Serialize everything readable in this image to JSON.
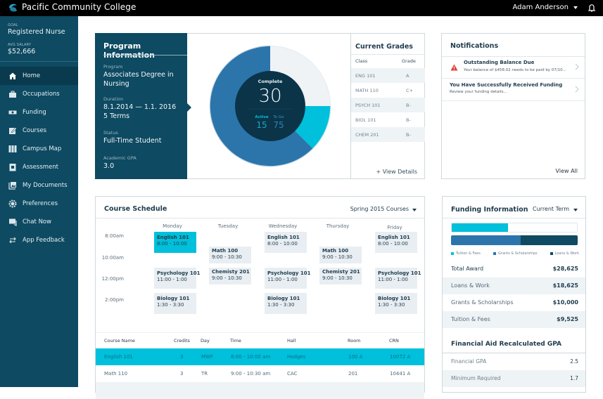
{
  "header": {
    "app_title": "Pacific Community College",
    "user_name": "Adam Anderson",
    "logo_icon": "wave-logo-icon",
    "bell_icon": "bell-icon"
  },
  "sidebar": {
    "goal_label": "GOAL",
    "goal_value": "Registered Nurse",
    "salary_label": "AVG SALARY",
    "salary_value": "$52,666",
    "items": [
      {
        "label": "Home",
        "icon": "home-icon",
        "active": true
      },
      {
        "label": "Occupations",
        "icon": "briefcase-icon"
      },
      {
        "label": "Funding",
        "icon": "money-icon"
      },
      {
        "label": "Courses",
        "icon": "edit-icon"
      },
      {
        "label": "Campus Map",
        "icon": "map-icon"
      },
      {
        "label": "Assessment",
        "icon": "clipboard-icon"
      },
      {
        "label": "My Documents",
        "icon": "documents-icon"
      },
      {
        "label": "Preferences",
        "icon": "gear-icon"
      },
      {
        "label": "Chat Now",
        "icon": "chat-icon"
      },
      {
        "label": "App Feedback",
        "icon": "arrows-icon"
      }
    ]
  },
  "program": {
    "title": "Program Information",
    "program_label": "Program",
    "program_value": "Associates Degree in Nursing",
    "duration_label": "Duration",
    "duration_value": "8.1.2014 — 1.1. 2016",
    "terms_value": "5 Terms",
    "status_label": "Status",
    "status_value": "Full-Time Student",
    "gpa_label": "Academic GPA",
    "gpa_value": "3.0"
  },
  "credits": {
    "complete_label": "Complete",
    "complete_value": "30",
    "active_label": "Active",
    "active_value": "15",
    "togo_label": "To Go",
    "togo_value": "75",
    "colors": {
      "complete": "#eff3f6",
      "active": "#00c0db",
      "togo": "#2b75ab",
      "center": "#0b3448"
    }
  },
  "grades": {
    "title": "Current Grades",
    "col_class": "Class",
    "col_grade": "Grade",
    "rows": [
      {
        "class": "ENG 101",
        "grade": "A"
      },
      {
        "class": "MATH 110",
        "grade": "C+"
      },
      {
        "class": "PSYCH 101",
        "grade": "B-"
      },
      {
        "class": "BIOL 101",
        "grade": "B-"
      },
      {
        "class": "CHEM 201",
        "grade": "B-"
      }
    ],
    "view_details": "+ View Details"
  },
  "notifications": {
    "title": "Notifications",
    "items": [
      {
        "title": "Outstanding Balance Due",
        "subtitle": "Your balance of $458.02 needs to be paid by 07/10...",
        "icon": "warning-icon"
      },
      {
        "title": "You Have Successfully Received Funding",
        "subtitle": "Review your funding details..."
      }
    ],
    "view_all": "View All"
  },
  "schedule": {
    "title": "Course Schedule",
    "term_select": "Spring 2015 Courses",
    "days": [
      "Monday",
      "Tuesday",
      "Wednesday",
      "Thursday",
      "Friday"
    ],
    "times": [
      "8:00am",
      "10:00am",
      "12:00pm",
      "2:00pm"
    ],
    "blocks": {
      "mon_eng": {
        "name": "English 101",
        "hours": "8:00 - 10:00"
      },
      "mon_psy": {
        "name": "Psychology 101",
        "hours": "11:00 - 1:00"
      },
      "mon_bio": {
        "name": "Biology 101",
        "hours": "1:30 - 3:30"
      },
      "tue_math": {
        "name": "Math 100",
        "hours": "9:00 - 10:30"
      },
      "tue_chem": {
        "name": "Chemisty 201",
        "hours": "9:00 - 10:30"
      },
      "wed_eng": {
        "name": "English 101",
        "hours": "8:00 - 10:00"
      },
      "wed_psy": {
        "name": "Psychology 101",
        "hours": "11:00 - 1:00"
      },
      "wed_bio": {
        "name": "Biology 101",
        "hours": "1:30 - 3:30"
      },
      "thu_math": {
        "name": "Math 100",
        "hours": "9:00 - 10:30"
      },
      "thu_chem": {
        "name": "Chemisty 201",
        "hours": "9:00 - 10:30"
      },
      "fri_eng": {
        "name": "English 101",
        "hours": "8:00 - 10:00"
      },
      "fri_psy": {
        "name": "Psychology 101",
        "hours": "11:00 - 1:00"
      },
      "fri_bio": {
        "name": "Biology 101",
        "hours": "1:30 - 3:30"
      }
    },
    "table": {
      "columns": [
        "Course Name",
        "Credits",
        "Day",
        "Time",
        "Hall",
        "Room",
        "CRN"
      ],
      "rows": [
        [
          "English 101",
          "3",
          "MWF",
          "8:00 - 10:00 am",
          "Hodges",
          "100 A",
          "10072 A"
        ],
        [
          "Math 110",
          "3",
          "TR",
          "9:00 - 10:30 am",
          "CAC",
          "201",
          "10441 A"
        ]
      ]
    },
    "highlight_color": "#00c0db"
  },
  "funding": {
    "title": "Funding Information",
    "term_select": "Current Term",
    "bars": {
      "tuition_fraction": 0.45,
      "grants_fraction": 0.55,
      "loans_fraction": 0.45
    },
    "legend": [
      {
        "label": "Tuition & Fees",
        "color": "#00c0db"
      },
      {
        "label": "Grants & Scholarships",
        "color": "#2b75ab"
      },
      {
        "label": "Loans & Work",
        "color": "#0e4a62"
      }
    ],
    "rows": [
      {
        "label": "Total Award",
        "value": "$28,625"
      },
      {
        "label": "Loans & Work",
        "value": "$18,625"
      },
      {
        "label": "Grants & Scholarships",
        "value": "$10,000"
      },
      {
        "label": "Tuition & Fees",
        "value": "$9,525"
      }
    ],
    "gpa_title": "Financial Aid Recalculated GPA",
    "gpa_rows": [
      {
        "label": "Financial GPA",
        "value": "2.5"
      },
      {
        "label": "Minimum Required",
        "value": "1.7"
      }
    ]
  }
}
